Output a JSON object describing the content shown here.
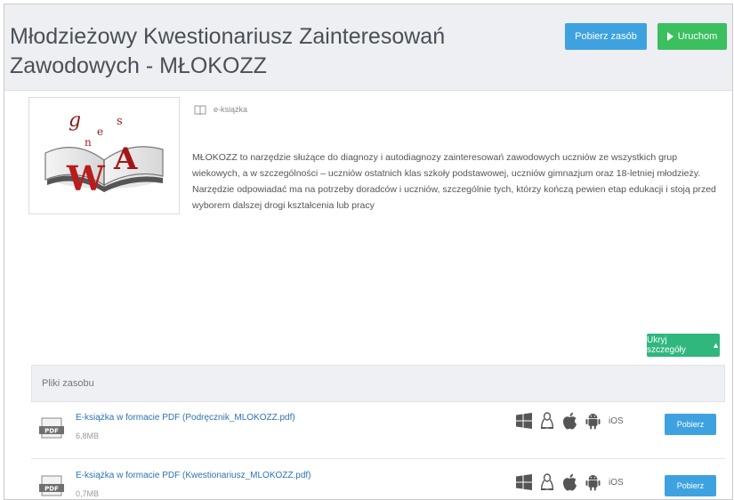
{
  "header": {
    "title": "Młodzieżowy Kwestionariusz Zainteresowań Zawodowych - MŁOKOZZ",
    "download_label": "Pobierz zasób",
    "run_label": "Uruchom"
  },
  "resource": {
    "type_label": "e-książka",
    "description": "MŁOKOZZ to narzędzie służące do diagnozy i autodiagnozy zainteresowań zawodowych uczniów ze wszystkich grup wiekowych, a w szczególności – uczniów ostatnich klas szkoły podstawowej, uczniów gimnazjum oraz 18-letniej młodzieży. Narzędzie odpowiadać ma na potrzeby doradców i uczniów, szczególnie tych, którzy kończą pewien etap edukacji i stoją przed wyborem dalszej drogi kształcenia lub pracy",
    "collapse_label": "Ukryj szczegóły"
  },
  "files": {
    "header": "Pliki zasobu",
    "items": [
      {
        "name": "E-książka w formacie PDF (Podręcznik_MLOKOZZ.pdf)",
        "size": "6,8MB",
        "icon": "pdf-file-icon",
        "platforms": [
          "windows-icon",
          "linux-icon",
          "apple-icon",
          "android-icon",
          "iOS"
        ],
        "action": "Pobierz"
      },
      {
        "name": "E-książka w formacie PDF (Kwestionariusz_MLOKOZZ.pdf)",
        "size": "0,7MB",
        "icon": "pdf-file-icon",
        "platforms": [
          "windows-icon",
          "linux-icon",
          "apple-icon",
          "android-icon",
          "iOS"
        ],
        "action": "Pobierz"
      }
    ]
  },
  "colors": {
    "primary_button": "#3fa2e0",
    "run_button": "#3bbf5f",
    "collapse_button": "#2fb77d",
    "link": "#2b73b7",
    "header_bg": "#edeff2"
  }
}
